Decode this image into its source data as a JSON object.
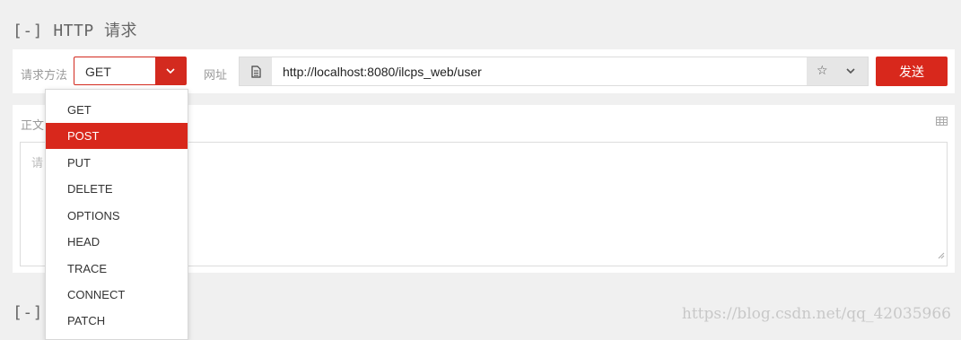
{
  "section": {
    "title": "[-] HTTP 请求",
    "second_title": "[-]"
  },
  "request": {
    "method_label": "请求方法",
    "method_value": "GET",
    "url_label": "网址",
    "url": "http://localhost:8080/ilcps_web/user",
    "send_label": "发送"
  },
  "body": {
    "label": "正文",
    "placeholder": "请"
  },
  "dropdown": {
    "options": [
      "GET",
      "POST",
      "PUT",
      "DELETE",
      "OPTIONS",
      "HEAD",
      "TRACE",
      "CONNECT",
      "PATCH"
    ],
    "highlighted": "POST"
  },
  "icons": [
    "chevron-down-icon",
    "document-icon",
    "star-icon",
    "table-icon",
    "resize-icon"
  ],
  "colors": {
    "accent": "#d8281c"
  },
  "watermark": "https://blog.csdn.net/qq_42035966"
}
